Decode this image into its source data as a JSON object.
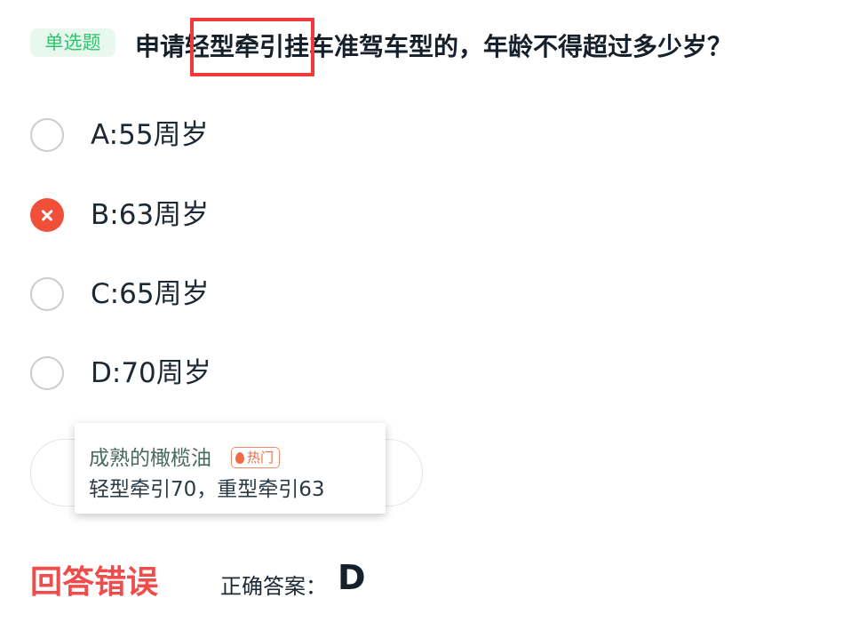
{
  "question": {
    "type_tag": "单选题",
    "title": "申请轻型牵引挂车准驾车型的，年龄不得超过多少岁？"
  },
  "options": [
    {
      "label": "A:55周岁",
      "state": "unselected"
    },
    {
      "label": "B:63周岁",
      "state": "wrong"
    },
    {
      "label": "C:65周岁",
      "state": "unselected"
    },
    {
      "label": "D:70周岁",
      "state": "unselected"
    }
  ],
  "comment": {
    "user": "成熟的橄榄油",
    "badge": "热门",
    "badge_icon": "flame-icon",
    "text": "轻型牵引70，重型牵引63"
  },
  "result": {
    "status": "回答错误",
    "answer_label": "正确答案：",
    "answer_value": "D"
  },
  "colors": {
    "tag_bg": "#e8f8ee",
    "tag_text": "#2fc46f",
    "wrong": "#f04f38",
    "highlight_border": "#ef3b3b",
    "result_text": "#ef4c4c"
  }
}
